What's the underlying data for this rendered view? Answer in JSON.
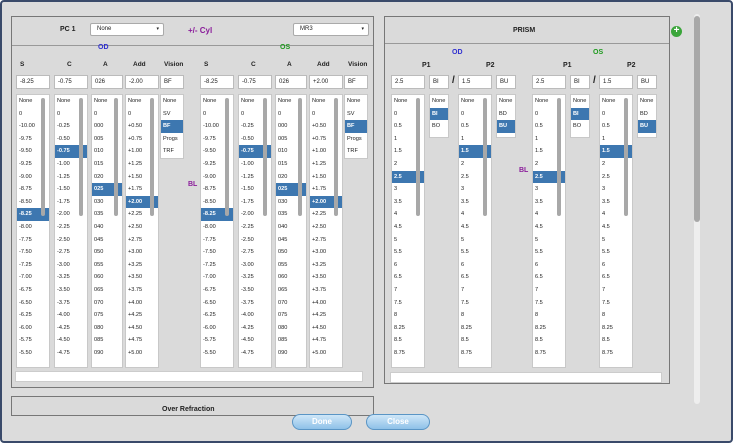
{
  "pc": {
    "label": "PC 1",
    "select_value": "None",
    "cyl_label": "+/- Cyl",
    "mode_value": "MR3"
  },
  "od": {
    "label": "OD",
    "cols": [
      "S",
      "C",
      "A",
      "Add",
      "Vision"
    ],
    "inputs": [
      "-8.25",
      "-0.75",
      "026",
      "-2.00",
      "BF"
    ]
  },
  "os": {
    "label": "OS",
    "cols": [
      "S",
      "C",
      "A",
      "Add",
      "Vision"
    ],
    "inputs": [
      "-8.25",
      "-0.75",
      "026",
      "+2.00",
      "BF"
    ]
  },
  "bl_label": "BL",
  "lists": {
    "s": [
      "None",
      "0",
      "-10.00",
      "-9.75",
      "-9.50",
      "-9.25",
      "-9.00",
      "-8.75",
      "-8.50",
      "-8.25",
      "-8.00",
      "-7.75",
      "-7.50",
      "-7.25",
      "-7.00",
      "-6.75",
      "-6.50",
      "-6.25",
      "-6.00",
      "-5.75",
      "-5.50"
    ],
    "c": [
      "None",
      "0",
      "-0.25",
      "-0.50",
      "-0.75",
      "-1.00",
      "-1.25",
      "-1.50",
      "-1.75",
      "-2.00",
      "-2.25",
      "-2.50",
      "-2.75",
      "-3.00",
      "-3.25",
      "-3.50",
      "-3.75",
      "-4.00",
      "-4.25",
      "-4.50",
      "-4.75"
    ],
    "a": [
      "None",
      "0",
      "000",
      "005",
      "010",
      "015",
      "020",
      "025",
      "030",
      "035",
      "040",
      "045",
      "050",
      "055",
      "060",
      "065",
      "070",
      "075",
      "080",
      "085",
      "090"
    ],
    "add": [
      "None",
      "0",
      "+0.50",
      "+0.75",
      "+1.00",
      "+1.25",
      "+1.50",
      "+1.75",
      "+2.00",
      "+2.25",
      "+2.50",
      "+2.75",
      "+3.00",
      "+3.25",
      "+3.50",
      "+3.75",
      "+4.00",
      "+4.25",
      "+4.50",
      "+4.75",
      "+5.00"
    ],
    "vision": [
      "None",
      "SV",
      "BF",
      "Progs",
      "TRF"
    ],
    "prism_p": [
      "None",
      "0",
      "0.5",
      "1",
      "1.5",
      "2",
      "2.5",
      "3",
      "3.5",
      "4",
      "4.5",
      "5",
      "5.5",
      "6",
      "6.5",
      "7",
      "7.5",
      "8",
      "8.25",
      "8.5",
      "8.75"
    ],
    "base_in": [
      "None",
      "BI",
      "BO"
    ],
    "base_up": [
      "None",
      "BD",
      "BU"
    ]
  },
  "selected": {
    "od_s": "-8.25",
    "od_c": "-0.75",
    "od_a": "025",
    "od_add": "+2.00",
    "od_vision": "BF",
    "os_s": "-8.25",
    "os_c": "-0.75",
    "os_a": "025",
    "os_add": "+2.00",
    "os_vision": "BF"
  },
  "prism": {
    "title": "PRISM",
    "od_label": "OD",
    "os_label": "OS",
    "bl_label": "BL",
    "p1": "P1",
    "p2": "P2",
    "slash": "/",
    "od_inputs": [
      "2.5",
      "BI",
      "1.5",
      "BU"
    ],
    "os_inputs": [
      "2.5",
      "BI",
      "1.5",
      "BU"
    ],
    "od_sel": {
      "p1": "2.5",
      "b1": "BI",
      "p2": "1.5",
      "b2": "BU"
    },
    "os_sel": {
      "p1": "2.5",
      "b1": "BI",
      "p2": "1.5",
      "b2": "BU"
    }
  },
  "over_refraction": "Over Refraction",
  "buttons": {
    "done": "Done",
    "close": "Close"
  },
  "colors": {
    "od": "#2f2fd0",
    "os": "#1d9a1d",
    "bl": "#8a1c9a",
    "accent": "#3d77b0"
  }
}
